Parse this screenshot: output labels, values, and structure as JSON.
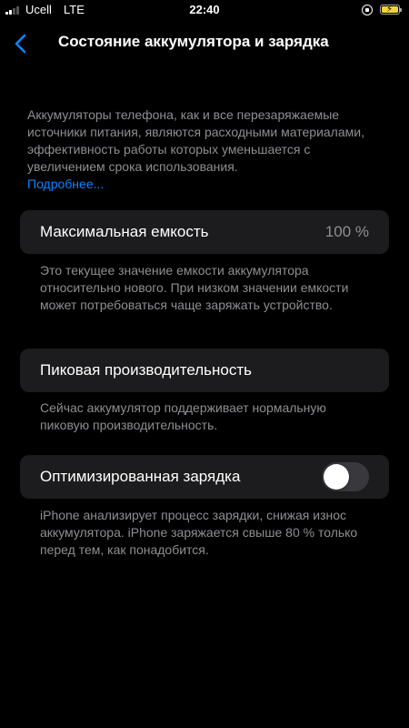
{
  "status_bar": {
    "carrier": "Ucell",
    "network": "LTE",
    "time": "22:40",
    "battery_color": "#f2d33a"
  },
  "nav": {
    "back_icon": "chevron-left-icon",
    "title": "Состояние аккумулятора и зарядка"
  },
  "intro": {
    "text": "Аккумуляторы телефона, как и все перезаряжаемые источники питания, являются расходными материалами, эффективность работы которых уменьшается с увеличением срока использования.",
    "link": "Подробнее..."
  },
  "capacity": {
    "label": "Максимальная емкость",
    "value": "100 %",
    "footer": "Это текущее значение емкости аккумулятора относительно нового. При низком значении емкости может потребоваться чаще заряжать устройство."
  },
  "peak": {
    "label": "Пиковая производительность",
    "footer": "Сейчас аккумулятор поддерживает нормальную пиковую производительность."
  },
  "optimized": {
    "label": "Оптимизированная зарядка",
    "enabled": false,
    "footer": "iPhone анализирует процесс зарядки, снижая износ аккумулятора. iPhone заряжается свыше 80 % только перед тем, как понадобится."
  },
  "colors": {
    "accent": "#0a84ff",
    "cell_bg": "#1c1c1e",
    "secondary_text": "#8e8e93"
  }
}
